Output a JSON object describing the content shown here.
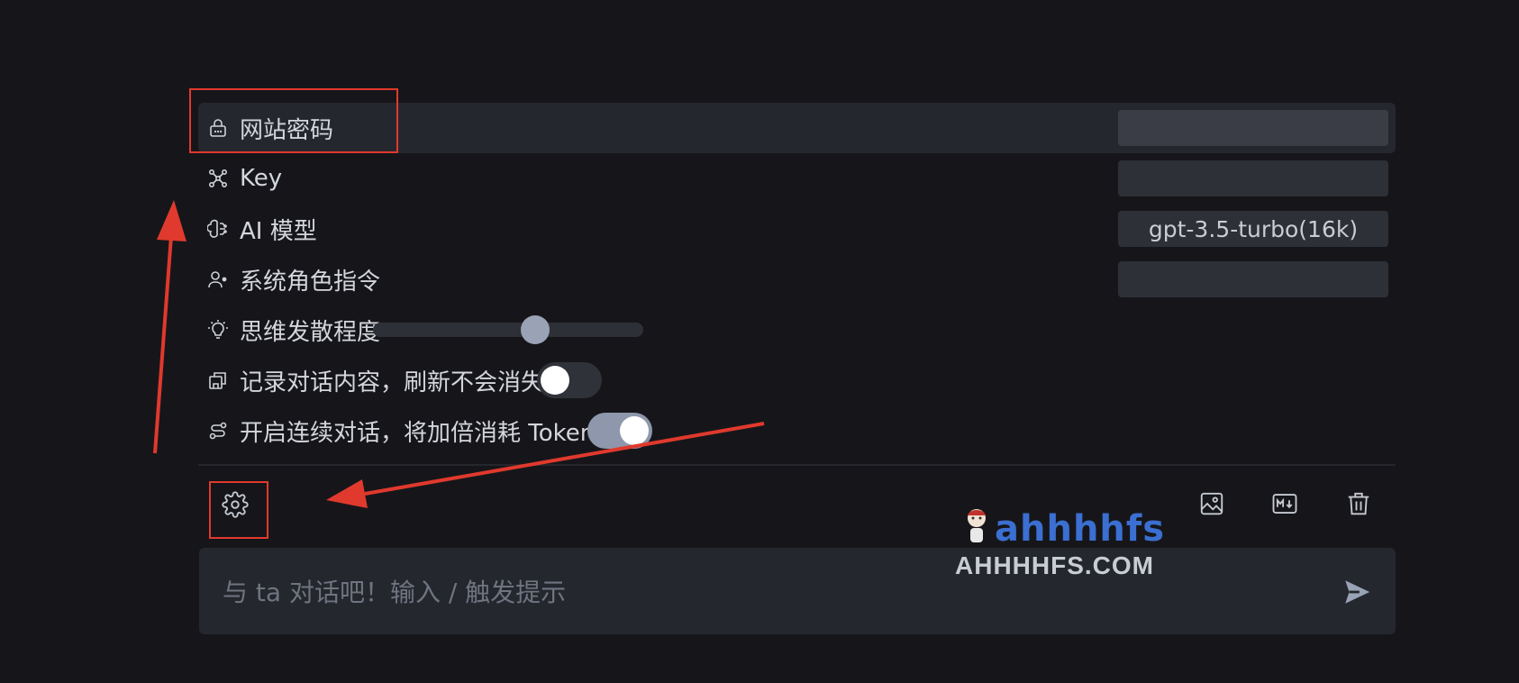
{
  "settings": {
    "rows": [
      {
        "label": "网站密码",
        "icon": "lock-icon",
        "control": "input",
        "value": ""
      },
      {
        "label": "Key",
        "icon": "key-nodes-icon",
        "control": "input",
        "value": ""
      },
      {
        "label": "AI 模型",
        "icon": "brain-icon",
        "control": "select",
        "value": "gpt-3.5-turbo(16k)"
      },
      {
        "label": "系统角色指令",
        "icon": "user-role-icon",
        "control": "input",
        "value": ""
      },
      {
        "label": "思维发散程度",
        "icon": "lightbulb-icon",
        "control": "slider",
        "value": 0.6
      },
      {
        "label": "记录对话内容，刷新不会消失",
        "icon": "save-history-icon",
        "control": "toggle",
        "value": false
      },
      {
        "label": "开启连续对话，将加倍消耗 Token",
        "icon": "continuous-chat-icon",
        "control": "toggle",
        "value": true
      }
    ]
  },
  "toolbar": {
    "settings_icon": "gear-icon",
    "right_icons": [
      "image-icon",
      "markdown-icon",
      "trash-icon"
    ]
  },
  "composer": {
    "placeholder": "与 ta 对话吧！输入 / 触发提示",
    "send_icon": "send-icon"
  },
  "watermark": {
    "brand": "ahhhhfs",
    "domain": "AHHHHFS.COM"
  },
  "colors": {
    "background": "#16161a",
    "panel": "#25272e",
    "annotation": "#e0392d",
    "toggle_on": "#8e97ab",
    "slider_thumb": "#9aa3b5"
  }
}
